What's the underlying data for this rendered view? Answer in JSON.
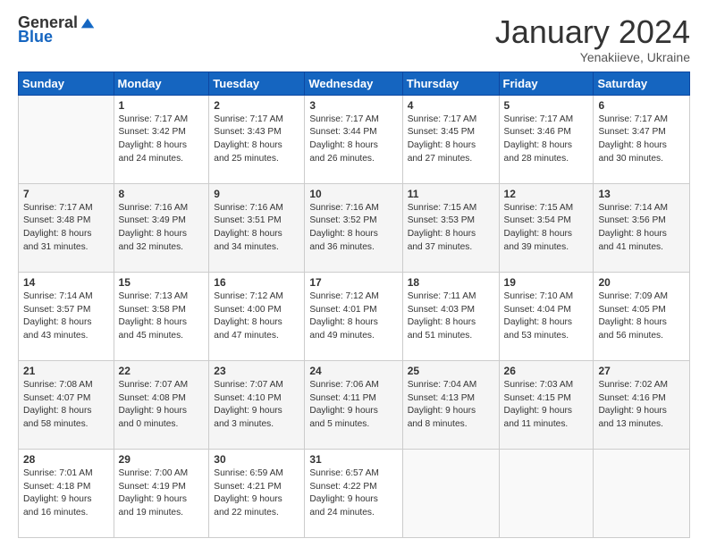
{
  "header": {
    "logo_general": "General",
    "logo_blue": "Blue",
    "title": "January 2024",
    "subtitle": "Yenakiieve, Ukraine"
  },
  "days_of_week": [
    "Sunday",
    "Monday",
    "Tuesday",
    "Wednesday",
    "Thursday",
    "Friday",
    "Saturday"
  ],
  "weeks": [
    [
      {
        "day": "",
        "info": ""
      },
      {
        "day": "1",
        "info": "Sunrise: 7:17 AM\nSunset: 3:42 PM\nDaylight: 8 hours\nand 24 minutes."
      },
      {
        "day": "2",
        "info": "Sunrise: 7:17 AM\nSunset: 3:43 PM\nDaylight: 8 hours\nand 25 minutes."
      },
      {
        "day": "3",
        "info": "Sunrise: 7:17 AM\nSunset: 3:44 PM\nDaylight: 8 hours\nand 26 minutes."
      },
      {
        "day": "4",
        "info": "Sunrise: 7:17 AM\nSunset: 3:45 PM\nDaylight: 8 hours\nand 27 minutes."
      },
      {
        "day": "5",
        "info": "Sunrise: 7:17 AM\nSunset: 3:46 PM\nDaylight: 8 hours\nand 28 minutes."
      },
      {
        "day": "6",
        "info": "Sunrise: 7:17 AM\nSunset: 3:47 PM\nDaylight: 8 hours\nand 30 minutes."
      }
    ],
    [
      {
        "day": "7",
        "info": "Sunrise: 7:17 AM\nSunset: 3:48 PM\nDaylight: 8 hours\nand 31 minutes."
      },
      {
        "day": "8",
        "info": "Sunrise: 7:16 AM\nSunset: 3:49 PM\nDaylight: 8 hours\nand 32 minutes."
      },
      {
        "day": "9",
        "info": "Sunrise: 7:16 AM\nSunset: 3:51 PM\nDaylight: 8 hours\nand 34 minutes."
      },
      {
        "day": "10",
        "info": "Sunrise: 7:16 AM\nSunset: 3:52 PM\nDaylight: 8 hours\nand 36 minutes."
      },
      {
        "day": "11",
        "info": "Sunrise: 7:15 AM\nSunset: 3:53 PM\nDaylight: 8 hours\nand 37 minutes."
      },
      {
        "day": "12",
        "info": "Sunrise: 7:15 AM\nSunset: 3:54 PM\nDaylight: 8 hours\nand 39 minutes."
      },
      {
        "day": "13",
        "info": "Sunrise: 7:14 AM\nSunset: 3:56 PM\nDaylight: 8 hours\nand 41 minutes."
      }
    ],
    [
      {
        "day": "14",
        "info": "Sunrise: 7:14 AM\nSunset: 3:57 PM\nDaylight: 8 hours\nand 43 minutes."
      },
      {
        "day": "15",
        "info": "Sunrise: 7:13 AM\nSunset: 3:58 PM\nDaylight: 8 hours\nand 45 minutes."
      },
      {
        "day": "16",
        "info": "Sunrise: 7:12 AM\nSunset: 4:00 PM\nDaylight: 8 hours\nand 47 minutes."
      },
      {
        "day": "17",
        "info": "Sunrise: 7:12 AM\nSunset: 4:01 PM\nDaylight: 8 hours\nand 49 minutes."
      },
      {
        "day": "18",
        "info": "Sunrise: 7:11 AM\nSunset: 4:03 PM\nDaylight: 8 hours\nand 51 minutes."
      },
      {
        "day": "19",
        "info": "Sunrise: 7:10 AM\nSunset: 4:04 PM\nDaylight: 8 hours\nand 53 minutes."
      },
      {
        "day": "20",
        "info": "Sunrise: 7:09 AM\nSunset: 4:05 PM\nDaylight: 8 hours\nand 56 minutes."
      }
    ],
    [
      {
        "day": "21",
        "info": "Sunrise: 7:08 AM\nSunset: 4:07 PM\nDaylight: 8 hours\nand 58 minutes."
      },
      {
        "day": "22",
        "info": "Sunrise: 7:07 AM\nSunset: 4:08 PM\nDaylight: 9 hours\nand 0 minutes."
      },
      {
        "day": "23",
        "info": "Sunrise: 7:07 AM\nSunset: 4:10 PM\nDaylight: 9 hours\nand 3 minutes."
      },
      {
        "day": "24",
        "info": "Sunrise: 7:06 AM\nSunset: 4:11 PM\nDaylight: 9 hours\nand 5 minutes."
      },
      {
        "day": "25",
        "info": "Sunrise: 7:04 AM\nSunset: 4:13 PM\nDaylight: 9 hours\nand 8 minutes."
      },
      {
        "day": "26",
        "info": "Sunrise: 7:03 AM\nSunset: 4:15 PM\nDaylight: 9 hours\nand 11 minutes."
      },
      {
        "day": "27",
        "info": "Sunrise: 7:02 AM\nSunset: 4:16 PM\nDaylight: 9 hours\nand 13 minutes."
      }
    ],
    [
      {
        "day": "28",
        "info": "Sunrise: 7:01 AM\nSunset: 4:18 PM\nDaylight: 9 hours\nand 16 minutes."
      },
      {
        "day": "29",
        "info": "Sunrise: 7:00 AM\nSunset: 4:19 PM\nDaylight: 9 hours\nand 19 minutes."
      },
      {
        "day": "30",
        "info": "Sunrise: 6:59 AM\nSunset: 4:21 PM\nDaylight: 9 hours\nand 22 minutes."
      },
      {
        "day": "31",
        "info": "Sunrise: 6:57 AM\nSunset: 4:22 PM\nDaylight: 9 hours\nand 24 minutes."
      },
      {
        "day": "",
        "info": ""
      },
      {
        "day": "",
        "info": ""
      },
      {
        "day": "",
        "info": ""
      }
    ]
  ]
}
